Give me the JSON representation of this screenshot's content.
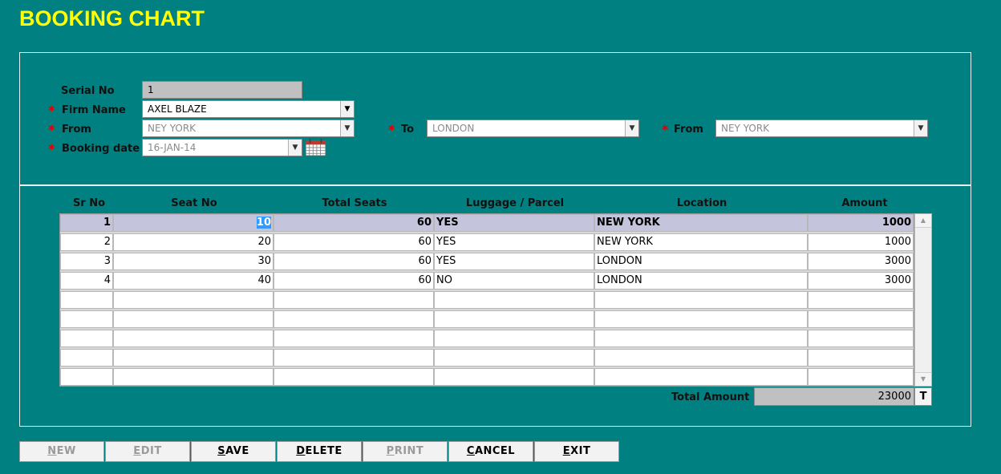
{
  "title": "BOOKING CHART",
  "form": {
    "serial_no": {
      "label": "Serial No",
      "value": "1"
    },
    "firm_name": {
      "label": "Firm Name",
      "value": "AXEL BLAZE"
    },
    "from": {
      "label": "From",
      "value": "NEY YORK"
    },
    "to": {
      "label": "To",
      "value": "LONDON"
    },
    "from2": {
      "label": "From",
      "value": "NEY YORK"
    },
    "booking_date": {
      "label": "Booking date",
      "value": "16-JAN-14"
    },
    "required_mark": "*"
  },
  "grid": {
    "columns": [
      "Sr No",
      "Seat No",
      "Total Seats",
      "Luggage / Parcel",
      "Location",
      "Amount"
    ],
    "rows": [
      {
        "sr": "1",
        "seat": "10",
        "total": "60",
        "luggage": "YES",
        "location": "NEW YORK",
        "amount": "1000"
      },
      {
        "sr": "2",
        "seat": "20",
        "total": "60",
        "luggage": "YES",
        "location": "NEW YORK",
        "amount": "1000"
      },
      {
        "sr": "3",
        "seat": "30",
        "total": "60",
        "luggage": "YES",
        "location": "LONDON",
        "amount": "3000"
      },
      {
        "sr": "4",
        "seat": "40",
        "total": "60",
        "luggage": "NO",
        "location": "LONDON",
        "amount": "3000"
      }
    ],
    "selected_row": 1
  },
  "total": {
    "label": "Total Amount",
    "value": "23000",
    "button": "T"
  },
  "buttons": [
    {
      "first": "N",
      "rest": "EW",
      "enabled": false
    },
    {
      "first": "E",
      "rest": "DIT",
      "enabled": false
    },
    {
      "first": "S",
      "rest": "AVE",
      "enabled": true
    },
    {
      "first": "D",
      "rest": "ELETE",
      "enabled": true
    },
    {
      "first": "P",
      "rest": "RINT",
      "enabled": false
    },
    {
      "first": "C",
      "rest": "ANCEL",
      "enabled": true
    },
    {
      "first": "E",
      "rest": "XIT",
      "enabled": true
    }
  ],
  "icons": {
    "dropdown": "chevron-down-icon",
    "calendar": "calendar-icon",
    "scroll_up": "scroll-up-icon",
    "scroll_down": "scroll-down-icon"
  }
}
